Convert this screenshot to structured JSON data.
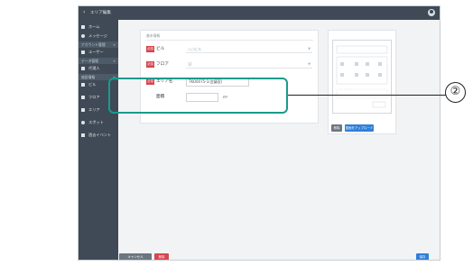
{
  "header": {
    "back_icon": "chevron-left-icon",
    "title": "エリア編集",
    "user_icon": "user-icon"
  },
  "sidebar": {
    "items": [
      {
        "label": "ホーム",
        "icon": "home-icon"
      },
      {
        "label": "メッセージ",
        "icon": "message-icon"
      },
      {
        "label": "ユーザー",
        "icon": "user-icon"
      },
      {
        "label": "代理人",
        "icon": "agent-icon"
      },
      {
        "label": "ビル",
        "icon": "building-icon"
      },
      {
        "label": "フロア",
        "icon": "floor-icon"
      },
      {
        "label": "エリア",
        "icon": "area-icon"
      },
      {
        "label": "スポット",
        "icon": "spot-icon"
      },
      {
        "label": "過去イベント",
        "icon": "event-icon"
      }
    ],
    "sections": [
      {
        "label": "アカウント管理",
        "toggle": "+"
      },
      {
        "label": "データ管理",
        "toggle": "+"
      },
      {
        "label": "施設情報",
        "toggle": "+"
      }
    ]
  },
  "form": {
    "section_label": "基本情報",
    "required_badge": "必須",
    "building": {
      "label": "ビル",
      "value": "○○ビル",
      "caret": "▼"
    },
    "floor": {
      "label": "フロア",
      "value": "1F",
      "caret": "▼"
    },
    "area_name": {
      "label": "エリア名",
      "value": "TKO0075-1(会議室)"
    },
    "area_size": {
      "label": "面積",
      "value": "",
      "unit": "m²"
    }
  },
  "callout": {
    "number": "②",
    "color": "#1a9a8d"
  },
  "map_panel": {
    "delete_label": "削除",
    "upload_label": "図面をアップロード"
  },
  "footer": {
    "cancel_label": "キャンセル",
    "delete_label": "削除",
    "save_label": "保存"
  },
  "colors": {
    "sidebar_bg": "#3f4a56",
    "required": "#d64550",
    "primary": "#2f7fd8",
    "neutral_button": "#6b7680"
  }
}
